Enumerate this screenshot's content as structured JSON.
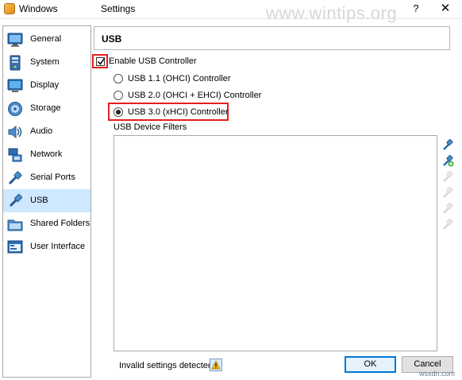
{
  "window": {
    "title_left": "Windows",
    "title_mid": "Settings",
    "help_label": "?",
    "close_label": "✕",
    "watermark": "www.wintips.org"
  },
  "sidebar": {
    "items": [
      {
        "label": "General",
        "icon": "general-icon",
        "selected": false
      },
      {
        "label": "System",
        "icon": "system-icon",
        "selected": false
      },
      {
        "label": "Display",
        "icon": "display-icon",
        "selected": false
      },
      {
        "label": "Storage",
        "icon": "storage-icon",
        "selected": false
      },
      {
        "label": "Audio",
        "icon": "audio-icon",
        "selected": false
      },
      {
        "label": "Network",
        "icon": "network-icon",
        "selected": false
      },
      {
        "label": "Serial Ports",
        "icon": "serial-ports-icon",
        "selected": false
      },
      {
        "label": "USB",
        "icon": "usb-icon",
        "selected": true
      },
      {
        "label": "Shared Folders",
        "icon": "shared-folders-icon",
        "selected": false
      },
      {
        "label": "User Interface",
        "icon": "user-interface-icon",
        "selected": false
      }
    ]
  },
  "main": {
    "header": "USB",
    "enable_usb": {
      "label": "Enable USB Controller",
      "checked": true
    },
    "controllers": [
      {
        "label": "USB 1.1 (OHCI) Controller",
        "selected": false
      },
      {
        "label": "USB 2.0 (OHCI + EHCI) Controller",
        "selected": false
      },
      {
        "label": "USB 3.0 (xHCI) Controller",
        "selected": true
      }
    ],
    "filters_label": "USB Device Filters",
    "filter_tools": [
      "add-empty-filter-icon",
      "add-device-filter-icon",
      "edit-filter-icon",
      "remove-filter-icon",
      "move-up-icon",
      "move-down-icon"
    ]
  },
  "footer": {
    "status": "Invalid settings detected",
    "ok_label": "OK",
    "cancel_label": "Cancel"
  },
  "brand": "wsxdn.com",
  "colors": {
    "highlight_box": "#e02020",
    "selected_item": "#cde8ff",
    "ok_border": "#0078d7"
  }
}
